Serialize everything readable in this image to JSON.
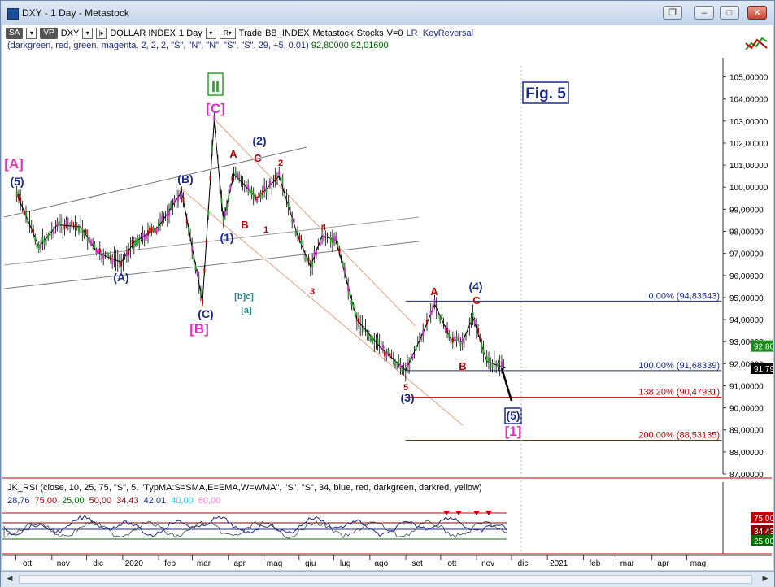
{
  "window": {
    "title": "DXY - 1 Day - Metastock",
    "buttons": [
      "restore-down",
      "minimize",
      "maximize",
      "close"
    ]
  },
  "toolbar": {
    "badge_sa": "SA",
    "badge_vp": "VP",
    "symbol": "DXY",
    "name": "DOLLAR INDEX",
    "period": "1 Day",
    "r": "R",
    "trade": "Trade",
    "source": "BB_INDEX",
    "app": "Metastock",
    "stocks": "Stocks",
    "v": "V=0",
    "indicator": "LR_KeyReversal"
  },
  "params": {
    "text": "(darkgreen, red, green, magenta, 2, 2, 2, \"S\", \"N\", \"N\", \"S\", \"S\", 29, +5, 0.01)",
    "v1": "92,80000",
    "v2": "92,01600"
  },
  "subchart": {
    "params": "JK_RSI    (close, 10, 25, 75, \"S\", 5, \"TypMA:S=SMA,E=EMA,W=WMA\", \"S\", \"S\", 34, blue, red, darkgreen, darkred, yellow)",
    "values": [
      {
        "text": "28,76",
        "color": "#1b2b8a"
      },
      {
        "text": "75,00",
        "color": "#c00000"
      },
      {
        "text": "25,00",
        "color": "#007000"
      },
      {
        "text": "50,00",
        "color": "#8b0000"
      },
      {
        "text": "34,43",
        "color": "#8b0000"
      },
      {
        "text": "42,01",
        "color": "#1b2b8a"
      },
      {
        "text": "40,00",
        "color": "#33ccee"
      },
      {
        "text": "60,00",
        "color": "#ff77cc"
      }
    ],
    "axis_badges": [
      "75,00",
      "34,43",
      "25,00"
    ]
  },
  "fig_label": "Fig. 5",
  "fib_levels": [
    {
      "label": "0,00% (94,83543)",
      "value": 94.83543,
      "color": "#1b2b8a",
      "x_start": "2020-08-31"
    },
    {
      "label": "100,00% (91,68339)",
      "value": 91.68339,
      "color": "#1b2b8a",
      "x_start": "2020-08-31"
    },
    {
      "label": "138,20% (90,47931)",
      "value": 90.47931,
      "color": "#c00000",
      "x_start": "2020-08-31"
    },
    {
      "label": "200,00% (88,53135)",
      "value": 88.53135,
      "color": "#c00000",
      "x_start": "2020-08-31"
    }
  ],
  "price_badges": [
    {
      "text": "92,80000",
      "color": "#1d8a1d"
    },
    {
      "text": "91,79000",
      "color": "#000000"
    }
  ],
  "chart_data": {
    "type": "candlestick",
    "y_axis": {
      "min": 87,
      "max": 105.5,
      "ticks": [
        "105,00000",
        "104,00000",
        "103,00000",
        "102,00000",
        "101,00000",
        "100,00000",
        "99,00000",
        "98,00000",
        "97,00000",
        "96,00000",
        "95,00000",
        "94,00000",
        "93,00000",
        "92,00000",
        "91,00000",
        "90,00000",
        "89,00000",
        "88,00000",
        "87,00000"
      ]
    },
    "x_axis": {
      "ticks": [
        "ott",
        "nov",
        "dic",
        "2020",
        "feb",
        "mar",
        "apr",
        "mag",
        "giu",
        "lug",
        "ago",
        "set",
        "ott",
        "nov",
        "dic",
        "2021",
        "feb",
        "mar",
        "apr",
        "mag"
      ]
    },
    "series": [
      {
        "name": "DXY",
        "x": [
          "2019-10-01",
          "2019-10-20",
          "2019-11-05",
          "2019-11-25",
          "2019-12-10",
          "2019-12-30",
          "2020-01-10",
          "2020-01-31",
          "2020-02-20",
          "2020-03-09",
          "2020-03-19",
          "2020-03-27",
          "2020-04-05",
          "2020-04-25",
          "2020-05-14",
          "2020-05-30",
          "2020-06-10",
          "2020-06-20",
          "2020-07-02",
          "2020-07-20",
          "2020-08-10",
          "2020-08-31",
          "2020-09-15",
          "2020-09-25",
          "2020-10-09",
          "2020-10-19",
          "2020-10-28",
          "2020-11-09",
          "2020-11-25"
        ],
        "y": [
          99.7,
          97.3,
          98.3,
          98.2,
          97.0,
          96.6,
          97.5,
          98.2,
          99.8,
          94.8,
          103.0,
          98.5,
          100.6,
          99.5,
          100.5,
          97.8,
          96.4,
          97.8,
          97.6,
          94.0,
          92.7,
          91.7,
          93.4,
          94.7,
          93.1,
          93.0,
          94.1,
          92.1,
          91.8
        ]
      }
    ],
    "wave_labels": [
      {
        "text": "[A]",
        "color": "#e030c0"
      },
      {
        "text": "(5)",
        "color": "#1b2b8a"
      },
      {
        "text": "(A)",
        "color": "#1b2b8a"
      },
      {
        "text": "(B)",
        "color": "#1b2b8a"
      },
      {
        "text": "II",
        "color": "#2aa02a"
      },
      {
        "text": "[C]",
        "color": "#e030c0"
      },
      {
        "text": "(C)",
        "color": "#1b2b8a"
      },
      {
        "text": "[B]",
        "color": "#e030c0"
      },
      {
        "text": "(1)",
        "color": "#1b2b8a"
      },
      {
        "text": "[b]c]",
        "color": "#2a8a8a"
      },
      {
        "text": "[a]",
        "color": "#2a8a8a"
      },
      {
        "text": "(2)",
        "color": "#1b2b8a"
      },
      {
        "text": "A",
        "color": "#c00000"
      },
      {
        "text": "B",
        "color": "#c00000"
      },
      {
        "text": "C",
        "color": "#c00000"
      },
      {
        "text": "1",
        "color": "#c00000"
      },
      {
        "text": "2",
        "color": "#c00000"
      },
      {
        "text": "3",
        "color": "#c00000"
      },
      {
        "text": "4",
        "color": "#c00000"
      },
      {
        "text": "5",
        "color": "#c00000"
      },
      {
        "text": "(3)",
        "color": "#1b2b8a"
      },
      {
        "text": "A",
        "color": "#c00000"
      },
      {
        "text": "(4)",
        "color": "#1b2b8a"
      },
      {
        "text": "C",
        "color": "#c00000"
      },
      {
        "text": "B",
        "color": "#c00000"
      },
      {
        "text": "(5)",
        "color": "#1b2b8a"
      },
      {
        "text": "[1]",
        "color": "#e030c0"
      }
    ]
  }
}
